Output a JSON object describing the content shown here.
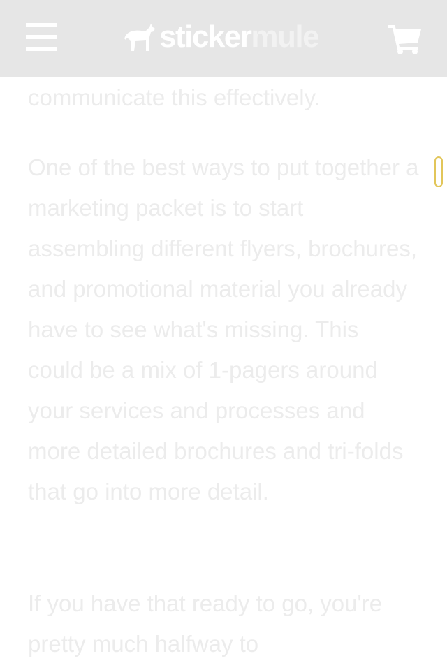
{
  "header": {
    "logo": {
      "part1": "sticker",
      "part2": "mule"
    },
    "icons": {
      "menu": "hamburger-menu-icon",
      "cart": "shopping-cart-icon",
      "logo": "mule-logo-icon"
    },
    "colors": {
      "background": "#e6e6e6",
      "foreground": "#ffffff"
    }
  },
  "article": {
    "paragraphs": [
      "communicate this effectively.",
      "One of the best ways to put together a marketing packet is to start assembling different flyers, brochures, and promotional material you already have to see what's missing. This could be a mix of 1-pagers around your services and processes and more detailed brochures and tri-folds that go into more detail.",
      "If you have that ready to go, you're pretty much halfway to"
    ],
    "text_color": "#ececec"
  },
  "scroll_indicator_color": "#e2c65a"
}
